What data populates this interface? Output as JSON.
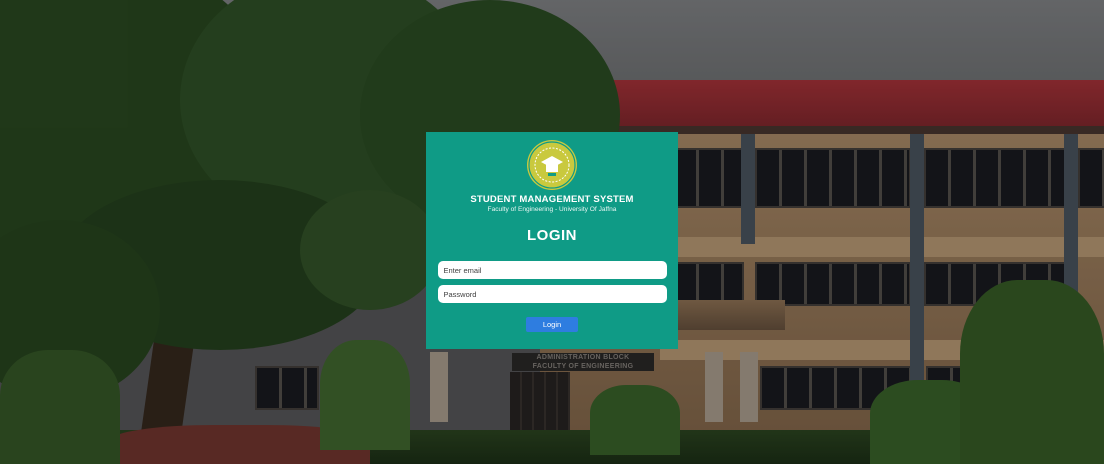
{
  "background": {
    "sign_line1": "ADMINISTRATION BLOCK",
    "sign_line2": "FACULTY OF ENGINEERING"
  },
  "card": {
    "logo_icon": "university-emblem-icon",
    "title": "STUDENT MANAGEMENT SYSTEM",
    "subtitle": "Faculty of Engineering - University Of Jaffna",
    "heading": "LOGIN",
    "email": {
      "value": "",
      "placeholder": "Enter email"
    },
    "password": {
      "value": "",
      "placeholder": "Password"
    },
    "login_button_label": "Login"
  },
  "colors": {
    "card_background": "#0f9b86",
    "button_background": "#2e7de0",
    "logo_color": "#c9c93e"
  }
}
